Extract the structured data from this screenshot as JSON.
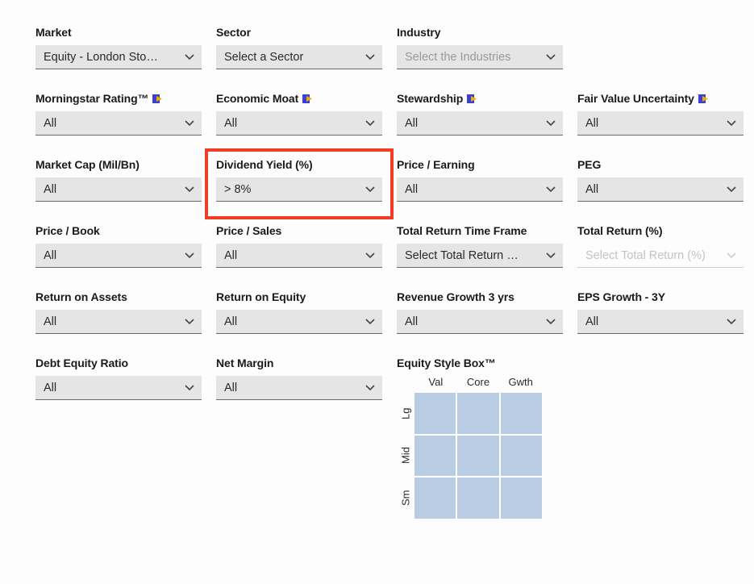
{
  "fields": [
    {
      "id": "market",
      "label": "Market",
      "value": "Equity - London Sto…",
      "premium": false
    },
    {
      "id": "sector",
      "label": "Sector",
      "value": "Select a Sector",
      "premium": false
    },
    {
      "id": "industry",
      "label": "Industry",
      "value": "Select the Industries",
      "premium": false,
      "placeholder": true
    },
    {
      "id": "spacer1",
      "empty": true
    },
    {
      "id": "morningstar-rating",
      "label": "Morningstar Rating™",
      "value": "All",
      "premium": true
    },
    {
      "id": "economic-moat",
      "label": "Economic Moat",
      "value": "All",
      "premium": true
    },
    {
      "id": "stewardship",
      "label": "Stewardship",
      "value": "All",
      "premium": true
    },
    {
      "id": "fair-value-uncertainty",
      "label": "Fair Value Uncertainty",
      "value": "All",
      "premium": true
    },
    {
      "id": "market-cap",
      "label": "Market Cap (Mil/Bn)",
      "value": "All",
      "premium": false
    },
    {
      "id": "dividend-yield",
      "label": "Dividend Yield (%)",
      "value": "> 8%",
      "premium": false,
      "highlighted": true
    },
    {
      "id": "price-earning",
      "label": "Price / Earning",
      "value": "All",
      "premium": false
    },
    {
      "id": "peg",
      "label": "PEG",
      "value": "All",
      "premium": false
    },
    {
      "id": "price-book",
      "label": "Price / Book",
      "value": "All",
      "premium": false
    },
    {
      "id": "price-sales",
      "label": "Price / Sales",
      "value": "All",
      "premium": false
    },
    {
      "id": "total-return-timeframe",
      "label": "Total Return Time Frame",
      "value": "Select Total Return …",
      "premium": false
    },
    {
      "id": "total-return-pct",
      "label": "Total Return (%)",
      "value": "Select Total Return (%)",
      "premium": false,
      "readonly": true
    },
    {
      "id": "return-on-assets",
      "label": "Return on Assets",
      "value": "All",
      "premium": false
    },
    {
      "id": "return-on-equity",
      "label": "Return on Equity",
      "value": "All",
      "premium": false
    },
    {
      "id": "revenue-growth",
      "label": "Revenue Growth 3 yrs",
      "value": "All",
      "premium": false
    },
    {
      "id": "eps-growth",
      "label": "EPS Growth - 3Y",
      "value": "All",
      "premium": false
    },
    {
      "id": "debt-equity",
      "label": "Debt Equity Ratio",
      "value": "All",
      "premium": false
    },
    {
      "id": "net-margin",
      "label": "Net Margin",
      "value": "All",
      "premium": false
    }
  ],
  "stylebox": {
    "label": "Equity Style Box™",
    "cols": [
      "Val",
      "Core",
      "Gwth"
    ],
    "rows": [
      "Lg",
      "Mid",
      "Sm"
    ]
  },
  "colors": {
    "highlight": "#ef3e23",
    "premium_bg": "#3a3fd6",
    "premium_arrow": "#f2a900",
    "cell": "#b8cde4"
  }
}
